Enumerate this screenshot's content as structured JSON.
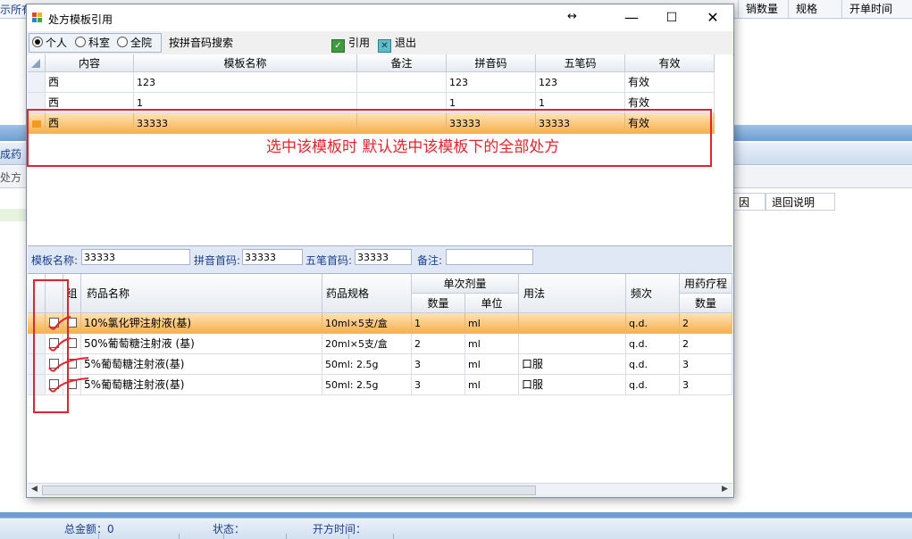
{
  "background": {
    "top_left_text": "示所有",
    "top_right_headers": [
      "销数量",
      "规格",
      "开单时间"
    ],
    "strip_label": "成药",
    "strip2_label": "处方",
    "side_grid_headers": [
      "因",
      "退回说明"
    ],
    "status": {
      "total": "总金额：0",
      "state": "状态：",
      "time": "开方时间："
    }
  },
  "dialog": {
    "title": "处方模板引用",
    "window_buttons": {
      "minimize": "—",
      "maximize": "☐",
      "close": "✕"
    },
    "resize_glyph": "↔",
    "scope_options": [
      {
        "label": "个人",
        "selected": true
      },
      {
        "label": "科室",
        "selected": false
      },
      {
        "label": "全院",
        "selected": false
      }
    ],
    "pinyin_search_label": "按拼音码搜索",
    "apply_label": "引用",
    "exit_label": "退出"
  },
  "template_grid": {
    "columns": [
      "内容",
      "模板名称",
      "备注",
      "拼音码",
      "五笔码",
      "有效"
    ],
    "rows": [
      {
        "content": "西",
        "name": "123",
        "note": "",
        "pinyin": "123",
        "wubi": "123",
        "valid": "有效",
        "selected": false
      },
      {
        "content": "西",
        "name": "1",
        "note": "",
        "pinyin": "1",
        "wubi": "1",
        "valid": "有效",
        "selected": false
      },
      {
        "content": "西",
        "name": "33333",
        "note": "",
        "pinyin": "33333",
        "wubi": "33333",
        "valid": "有效",
        "selected": true
      }
    ],
    "annotation": "选中该模板时 默认选中该模板下的全部处方"
  },
  "fields": {
    "template_name_label": "模板名称:",
    "template_name_value": "33333",
    "pinyin_label": "拼音首码:",
    "pinyin_value": "33333",
    "wubi_label": "五笔首码:",
    "wubi_value": "33333",
    "note_label": "备注:",
    "note_value": ""
  },
  "drug_grid": {
    "headers": {
      "group": "组",
      "drug_name": "药品名称",
      "spec": "药品规格",
      "single_dose": "单次剂量",
      "qty": "数量",
      "unit": "单位",
      "usage": "用法",
      "frequency": "频次",
      "course": "用药疗程",
      "course_qty": "数量"
    },
    "rows": [
      {
        "name": "10%氯化钾注射液(基)",
        "spec": "10ml×5支/盒",
        "qty": "1",
        "unit": "ml",
        "usage": "",
        "freq": "q.d.",
        "course": "2",
        "selected": true
      },
      {
        "name": "50%葡萄糖注射液 (基)",
        "spec": "20ml×5支/盒",
        "qty": "2",
        "unit": "ml",
        "usage": "",
        "freq": "q.d.",
        "course": "2",
        "selected": false
      },
      {
        "name": "5%葡萄糖注射液(基)",
        "spec": "50ml: 2.5g",
        "qty": "3",
        "unit": "ml",
        "usage": "口服",
        "freq": "q.d.",
        "course": "3",
        "selected": false
      },
      {
        "name": "5%葡萄糖注射液(基)",
        "spec": "50ml: 2.5g",
        "qty": "3",
        "unit": "ml",
        "usage": "口服",
        "freq": "q.d.",
        "course": "3",
        "selected": false
      }
    ]
  },
  "colors": {
    "selection": "#f8b04e",
    "annotation": "#e1242b",
    "accent": "#1b3f8b"
  }
}
